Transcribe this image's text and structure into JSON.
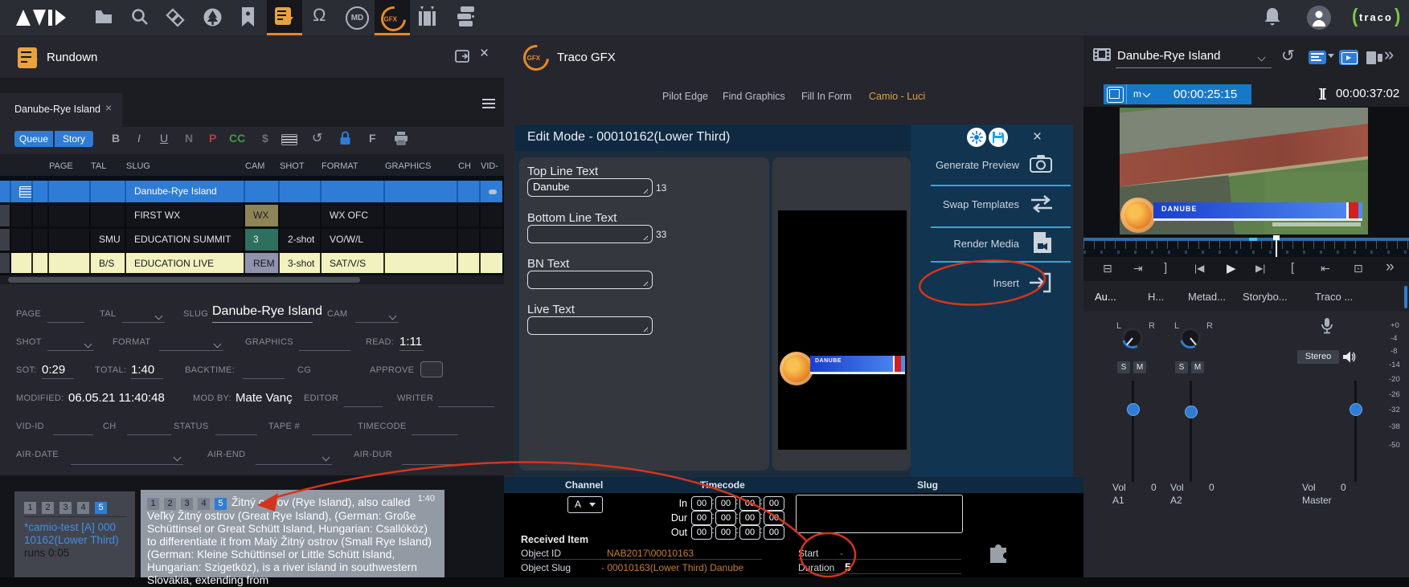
{
  "topbar": {
    "omega": "Ω",
    "md": "MD",
    "gfx": "GFX",
    "traco": "traco"
  },
  "rundown": {
    "title": "Rundown",
    "tab": {
      "label": "Danube-Rye Island"
    },
    "toolbar": {
      "queue": "Queue",
      "story": "Story",
      "bold": "B",
      "italic": "I",
      "underline": "U",
      "normal": "N",
      "presenter": "P",
      "cc": "CC",
      "dollar": "$",
      "f": "F"
    },
    "table": {
      "headers": [
        "PAGE",
        "TAL",
        "SLUG",
        "CAM",
        "SHOT",
        "FORMAT",
        "GRAPHICS",
        "CH",
        "VID-"
      ],
      "rows": [
        {
          "tal": "",
          "slug": "Danube-Rye Island",
          "cam": "",
          "shot": "",
          "format": ""
        },
        {
          "tal": "",
          "slug": "FIRST WX",
          "cam": "WX",
          "shot": "",
          "format": "WX OFC"
        },
        {
          "tal": "SMU",
          "slug": "EDUCATION SUMMIT",
          "cam": "3",
          "shot": "2-shot",
          "format": "VO/W/L"
        },
        {
          "tal": "B/S",
          "slug": "EDUCATION LIVE",
          "cam": "REM",
          "shot": "3-shot",
          "format": "SAT/V/S"
        }
      ]
    },
    "form": {
      "page_label": "PAGE",
      "tal_label": "TAL",
      "slug_label": "SLUG",
      "slug_value": "Danube-Rye Island",
      "cam_label": "CAM",
      "shot_label": "SHOT",
      "format_label": "FORMAT",
      "graphics_label": "GRAPHICS",
      "read_label": "READ:",
      "read_value": "1:11",
      "sot_label": "SOT:",
      "sot_value": "0:29",
      "total_label": "TOTAL:",
      "total_value": "1:40",
      "backtime_label": "BACKTIME:",
      "cg_label": "CG",
      "approve_label": "APPROVE",
      "modified_label": "MODIFIED:",
      "modified_value": "06.05.21 11:40:48",
      "modby_label": "MOD BY:",
      "modby_value": "Mate Vanç",
      "editor_label": "EDITOR",
      "writer_label": "WRITER",
      "vidid_label": "VID-ID",
      "ch_label": "CH",
      "status_label": "STATUS",
      "tape_label": "TAPE #",
      "timecode_label": "TIMECODE",
      "airdate_label": "AIR-DATE",
      "airend_label": "AIR-END",
      "airdur_label": "AIR-DUR"
    },
    "script": {
      "pages": [
        "1",
        "2",
        "3",
        "4",
        "5"
      ],
      "duration": "1:40",
      "item_line1": "*camio-test [A]  000",
      "item_line2": "10162(Lower Third)",
      "item_runs": "runs 0:05",
      "story_text": "Žitný ostrov (Rye Island), also called Veľký Žitný ostrov (Great Rye Island), (German: Große Schüttinsel or Great Schütt Island, Hungarian: Csallóköz) to differentiate it from Malý Žitný ostrov (Small Rye Island) (German: Kleine Schüttinsel or Little Schütt Island, Hungarian: Szigetköz), is a river island in southwestern Slovakia, extending from"
    }
  },
  "gfx": {
    "title": "Traco GFX",
    "tabs": [
      "Pilot Edge",
      "Find Graphics",
      "Fill In Form",
      "Camio - Luci"
    ],
    "modal": {
      "title": "Edit Mode - 00010162(Lower Third)",
      "fields": [
        {
          "label": "Top Line Text",
          "value": "Danube",
          "count": "13"
        },
        {
          "label": "Bottom Line Text",
          "value": "",
          "count": "33"
        },
        {
          "label": "BN Text",
          "value": ""
        },
        {
          "label": "Live Text",
          "value": ""
        }
      ],
      "preview_banner_text": "DANUBE",
      "actions": [
        "Generate Preview",
        "Swap Templates",
        "Render Media",
        "Insert"
      ]
    },
    "controls": {
      "channel_header": "Channel",
      "timecode_header": "Timecode",
      "slug_header": "Slug",
      "channel_value": "A",
      "in_label": "In",
      "dur_label": "Dur",
      "out_label": "Out",
      "tc_value": "00"
    },
    "received": {
      "title": "Received Item",
      "object_id_label": "Object ID",
      "object_id_value": "NAB2017\\00010163",
      "start_label": "Start",
      "start_value": "-",
      "object_slug_label": "Object Slug",
      "object_slug_value": "- 00010163(Lower Third) Danube",
      "duration_label": "Duration",
      "duration_value": "5"
    }
  },
  "player": {
    "asset_name": "Danube-Rye Island",
    "audio_mode": "m",
    "tc_position": "00:00:25:15",
    "tc_inout": "][",
    "tc_duration": "00:00:37:02",
    "banner_text": "DANUBE",
    "tabs": [
      "Au...",
      "H...",
      "Metad...",
      "Storybo...",
      "Traco ..."
    ],
    "transport": [
      "⊟",
      "⇥",
      "]",
      "|◀",
      "▶",
      "▶|",
      "[",
      "⇤",
      "⊡",
      "»"
    ],
    "mixer": {
      "strip1": {
        "left": "L",
        "right": "R",
        "solo": "S",
        "mute": "M",
        "vol_label": "Vol",
        "vol_value": "0",
        "name": "A1"
      },
      "strip2": {
        "left": "L",
        "right": "R",
        "solo": "S",
        "mute": "M",
        "vol_label": "Vol",
        "vol_value": "0",
        "name": "A2"
      },
      "master": {
        "stereo_label": "Stereo",
        "vol_label": "Vol",
        "vol_value": "0",
        "name": "Master"
      },
      "scale": [
        "+0",
        "-4",
        "-8",
        "-14",
        "-20",
        "-26",
        "-32",
        "-38",
        "-50"
      ]
    }
  },
  "colors": {
    "accent_blue": "#2e7cd6",
    "player_blue": "#1878c8",
    "orange": "#e8872a",
    "navy": "#113450",
    "cyan_divider": "#2ba8e8",
    "row_yellow": "#f2f2c0",
    "annotation_red": "#d4341c",
    "camio_link_blue": "#3f8fe8",
    "value_orange": "#c87d2a"
  }
}
